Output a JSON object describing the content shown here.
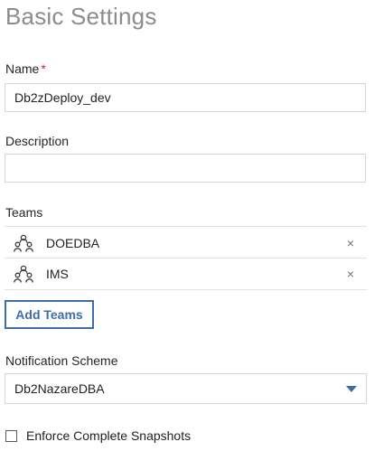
{
  "page": {
    "title": "Basic Settings"
  },
  "name_field": {
    "label": "Name",
    "required_mark": "*",
    "value": "Db2zDeploy_dev"
  },
  "description_field": {
    "label": "Description",
    "value": ""
  },
  "teams": {
    "label": "Teams",
    "items": [
      {
        "name": "DOEDBA",
        "icon": "team-icon",
        "remove": "×"
      },
      {
        "name": "IMS",
        "icon": "team-icon",
        "remove": "×"
      }
    ],
    "add_button": "Add Teams"
  },
  "notification_scheme": {
    "label": "Notification Scheme",
    "selected": "Db2NazareDBA",
    "icon": "caret-down-icon"
  },
  "enforce_snapshots": {
    "label": "Enforce Complete Snapshots",
    "checked": false
  },
  "colors": {
    "accent": "#3f6da7",
    "required": "#da1e28",
    "title": "#8c8c8c"
  }
}
